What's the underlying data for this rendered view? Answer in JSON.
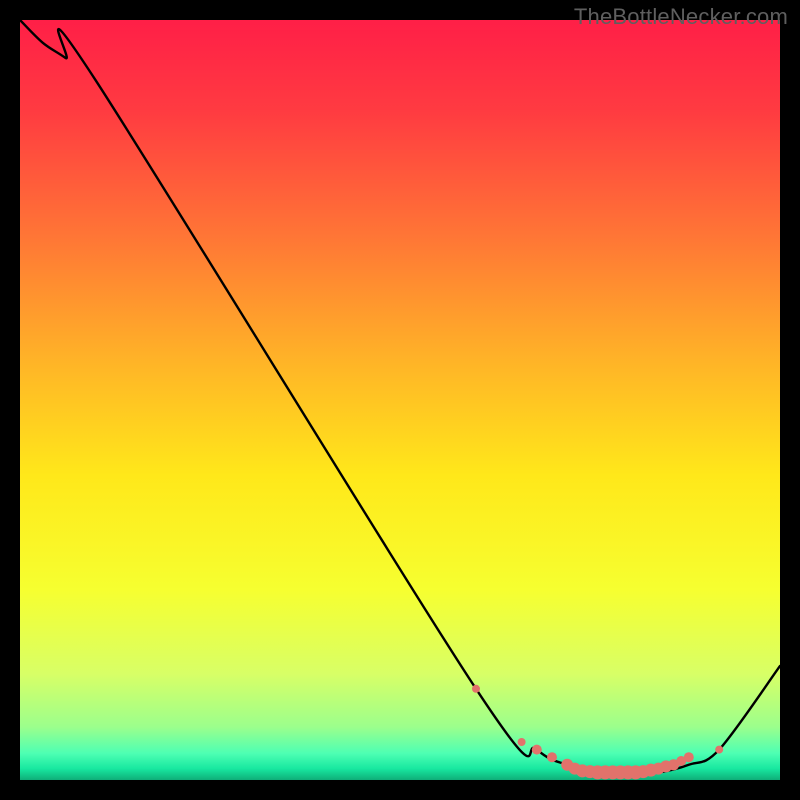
{
  "watermark": "TheBottleNecker.com",
  "chart_data": {
    "type": "line",
    "title": "",
    "xlabel": "",
    "ylabel": "",
    "xlim": [
      0,
      100
    ],
    "ylim": [
      0,
      100
    ],
    "series": [
      {
        "name": "curve",
        "x": [
          0,
          3,
          6,
          10,
          60,
          68,
          72,
          76,
          80,
          84,
          88,
          92,
          100
        ],
        "y": [
          100,
          97,
          95,
          92,
          12,
          4,
          2,
          1,
          1,
          1,
          2,
          4,
          15
        ]
      }
    ],
    "markers": {
      "name": "highlight-points",
      "color": "#e2726b",
      "x": [
        60,
        66,
        68,
        70,
        72,
        73,
        74,
        75,
        76,
        77,
        78,
        79,
        80,
        81,
        82,
        83,
        84,
        85,
        86,
        87,
        88,
        92
      ],
      "y": [
        12,
        5,
        4,
        3,
        2,
        1.5,
        1.2,
        1.1,
        1,
        1,
        1,
        1,
        1,
        1,
        1.1,
        1.3,
        1.5,
        1.8,
        2,
        2.5,
        3,
        4
      ],
      "sizes": [
        4,
        4,
        5,
        5,
        6,
        6,
        6.5,
        6.5,
        7,
        7,
        7,
        7,
        7,
        7,
        6.5,
        6.5,
        6,
        6,
        5.5,
        5,
        5,
        4
      ]
    },
    "background_gradient": {
      "stops": [
        {
          "offset": 0.0,
          "color": "#ff1f47"
        },
        {
          "offset": 0.12,
          "color": "#ff3b41"
        },
        {
          "offset": 0.28,
          "color": "#ff7436"
        },
        {
          "offset": 0.45,
          "color": "#ffb427"
        },
        {
          "offset": 0.6,
          "color": "#ffe81a"
        },
        {
          "offset": 0.75,
          "color": "#f6ff30"
        },
        {
          "offset": 0.86,
          "color": "#d8ff66"
        },
        {
          "offset": 0.93,
          "color": "#9cff8c"
        },
        {
          "offset": 0.965,
          "color": "#4dffb3"
        },
        {
          "offset": 0.985,
          "color": "#18e8a0"
        },
        {
          "offset": 1.0,
          "color": "#0fae78"
        }
      ]
    }
  }
}
